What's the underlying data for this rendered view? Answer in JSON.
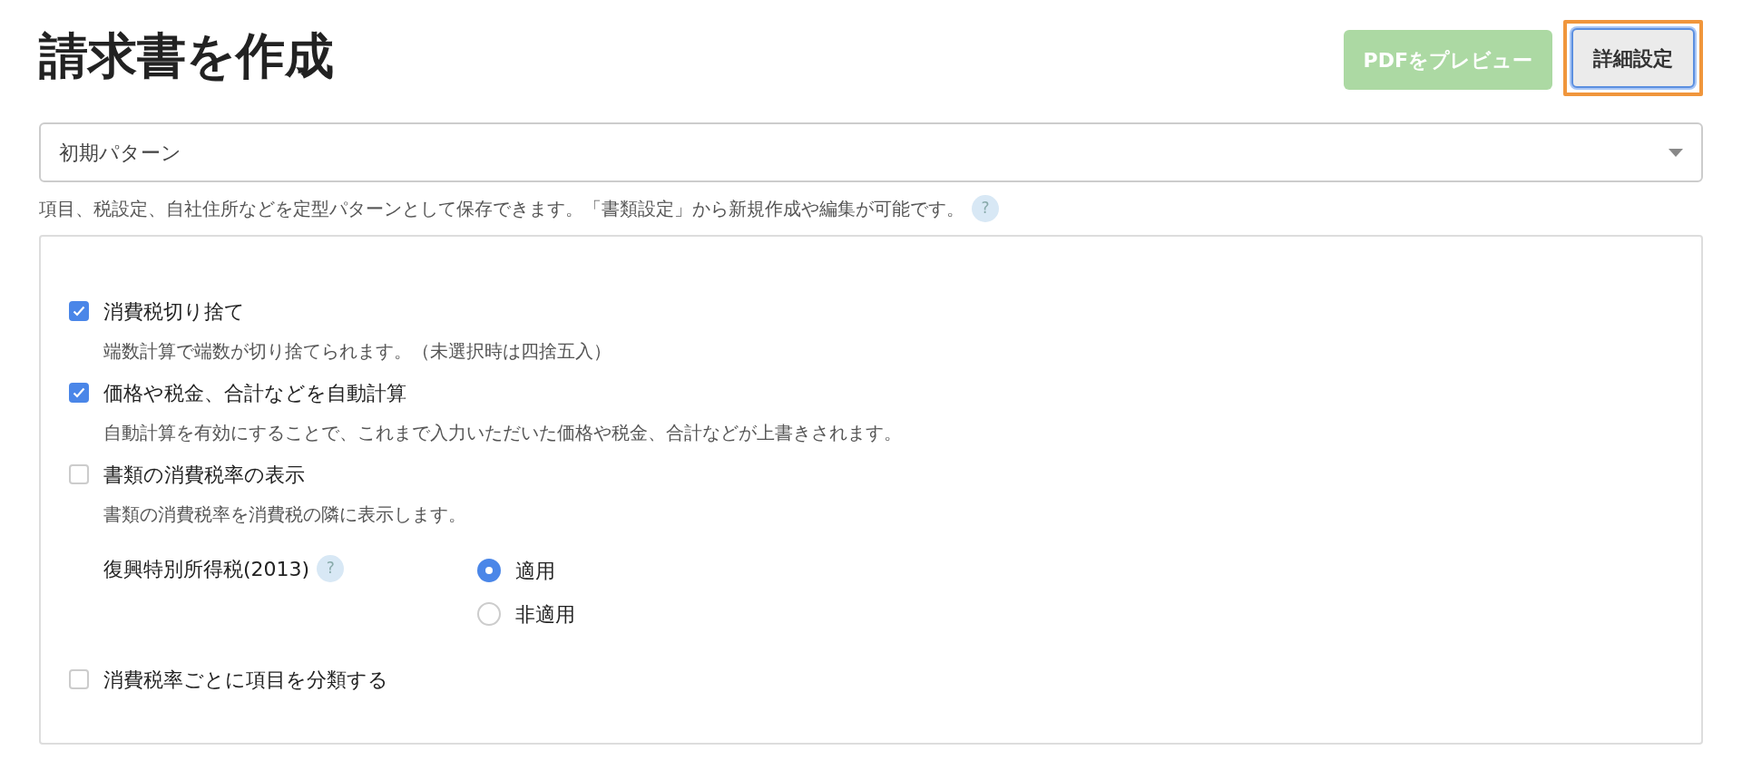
{
  "title": "請求書を作成",
  "header_buttons": [
    {
      "label": "PDFをプレビュー",
      "kind": "primary",
      "disabled": true,
      "highlighted": false
    },
    {
      "label": "詳細設定",
      "kind": "secondary",
      "disabled": false,
      "highlighted": true
    }
  ],
  "pattern_select": {
    "value": "初期パターン"
  },
  "pattern_help": {
    "text": "項目、税設定、自社住所などを定型パターンとして保存できます。「書類設定」から新規作成や編集が可能です。",
    "help_icon": "?"
  },
  "options": [
    {
      "kind": "checkbox",
      "label": "消費税切り捨て",
      "checked": true,
      "description": "端数計算で端数が切り捨てられます。（未選択時は四捨五入）"
    },
    {
      "kind": "checkbox",
      "label": "価格や税金、合計などを自動計算",
      "checked": true,
      "description": "自動計算を有効にすることで、これまで入力いただいた価格や税金、合計などが上書きされます。"
    },
    {
      "kind": "checkbox",
      "label": "書類の消費税率の表示",
      "checked": false,
      "description": "書類の消費税率を消費税の隣に表示します。"
    },
    {
      "kind": "radio_group",
      "label": "復興特別所得税(2013)",
      "help_icon": "?",
      "choices": [
        {
          "label": "適用",
          "selected": true
        },
        {
          "label": "非適用",
          "selected": false
        }
      ]
    },
    {
      "kind": "checkbox",
      "label": "消費税率ごとに項目を分類する",
      "checked": false
    }
  ]
}
